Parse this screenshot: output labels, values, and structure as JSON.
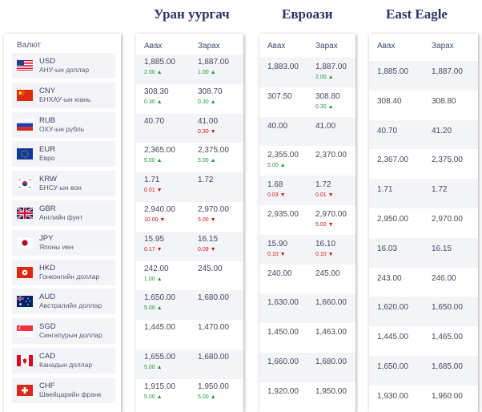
{
  "banks": {
    "ub": "Уран уургач",
    "ea": "Евроази",
    "eg": "East Eagle"
  },
  "headers": {
    "currency": "Валют",
    "buy": "Авах",
    "sell": "Зарах"
  },
  "currencies": [
    {
      "code": "USD",
      "name": "АНУ-ын доллар",
      "flag": "us-flag-icon"
    },
    {
      "code": "CNY",
      "name": "БНХАУ-ын юань",
      "flag": "cn-flag-icon"
    },
    {
      "code": "RUB",
      "name": "ОХУ-ын рубль",
      "flag": "ru-flag-icon"
    },
    {
      "code": "EUR",
      "name": "Евро",
      "flag": "eu-flag-icon"
    },
    {
      "code": "KRW",
      "name": "БНСУ-ын вон",
      "flag": "kr-flag-icon"
    },
    {
      "code": "GBR",
      "name": "Английн фунт",
      "flag": "gb-flag-icon"
    },
    {
      "code": "JPY",
      "name": "Японы иен",
      "flag": "jp-flag-icon"
    },
    {
      "code": "HKD",
      "name": "Гонконгийн доллар",
      "flag": "hk-flag-icon"
    },
    {
      "code": "AUD",
      "name": "Австралийн доллар",
      "flag": "au-flag-icon"
    },
    {
      "code": "SGD",
      "name": "Сингапурын доллар",
      "flag": "sg-flag-icon"
    },
    {
      "code": "CAD",
      "name": "Канадын доллар",
      "flag": "ca-flag-icon"
    },
    {
      "code": "CHF",
      "name": "Швейцарийн франк",
      "flag": "ch-flag-icon"
    }
  ],
  "rates": {
    "ub": [
      {
        "buy": "1,885.00",
        "buy_chg": "2.00",
        "buy_dir": "up",
        "sell": "1,887.00",
        "sell_chg": "1.00",
        "sell_dir": "up"
      },
      {
        "buy": "308.30",
        "buy_chg": "0.30",
        "buy_dir": "up",
        "sell": "308.70",
        "sell_chg": "0.30",
        "sell_dir": "up"
      },
      {
        "buy": "40.70",
        "buy_chg": "",
        "buy_dir": "",
        "sell": "41.00",
        "sell_chg": "0.30",
        "sell_dir": "down"
      },
      {
        "buy": "2,365.00",
        "buy_chg": "5.00",
        "buy_dir": "up",
        "sell": "2,375.00",
        "sell_chg": "5.00",
        "sell_dir": "up"
      },
      {
        "buy": "1.71",
        "buy_chg": "0.01",
        "buy_dir": "down",
        "sell": "1.72",
        "sell_chg": "",
        "sell_dir": ""
      },
      {
        "buy": "2,940.00",
        "buy_chg": "10.00",
        "buy_dir": "down",
        "sell": "2,970.00",
        "sell_chg": "5.00",
        "sell_dir": "down"
      },
      {
        "buy": "15.95",
        "buy_chg": "0.17",
        "buy_dir": "down",
        "sell": "16.15",
        "sell_chg": "0.09",
        "sell_dir": "down"
      },
      {
        "buy": "242.00",
        "buy_chg": "1.00",
        "buy_dir": "up",
        "sell": "245.00",
        "sell_chg": "",
        "sell_dir": ""
      },
      {
        "buy": "1,650.00",
        "buy_chg": "5.00",
        "buy_dir": "up",
        "sell": "1,680.00",
        "sell_chg": "",
        "sell_dir": ""
      },
      {
        "buy": "1,445.00",
        "buy_chg": "",
        "buy_dir": "",
        "sell": "1,470.00",
        "sell_chg": "",
        "sell_dir": ""
      },
      {
        "buy": "1,655.00",
        "buy_chg": "5.00",
        "buy_dir": "up",
        "sell": "1,680.00",
        "sell_chg": "",
        "sell_dir": ""
      },
      {
        "buy": "1,915.00",
        "buy_chg": "5.00",
        "buy_dir": "up",
        "sell": "1,950.00",
        "sell_chg": "5.00",
        "sell_dir": "up"
      }
    ],
    "ea": [
      {
        "buy": "1,883.00",
        "buy_chg": "",
        "buy_dir": "",
        "sell": "1,887.00",
        "sell_chg": "2.00",
        "sell_dir": "up"
      },
      {
        "buy": "307.50",
        "buy_chg": "",
        "buy_dir": "",
        "sell": "308.80",
        "sell_chg": "0.30",
        "sell_dir": "up"
      },
      {
        "buy": "40.00",
        "buy_chg": "",
        "buy_dir": "",
        "sell": "41.00",
        "sell_chg": "",
        "sell_dir": ""
      },
      {
        "buy": "2,355.00",
        "buy_chg": "5.00",
        "buy_dir": "up",
        "sell": "2,370.00",
        "sell_chg": "",
        "sell_dir": ""
      },
      {
        "buy": "1.68",
        "buy_chg": "0.03",
        "buy_dir": "down",
        "sell": "1.72",
        "sell_chg": "0.01",
        "sell_dir": "down"
      },
      {
        "buy": "2,935.00",
        "buy_chg": "",
        "buy_dir": "",
        "sell": "2,970.00",
        "sell_chg": "5.00",
        "sell_dir": "down"
      },
      {
        "buy": "15.90",
        "buy_chg": "0.10",
        "buy_dir": "down",
        "sell": "16.10",
        "sell_chg": "0.10",
        "sell_dir": "down"
      },
      {
        "buy": "240.00",
        "buy_chg": "",
        "buy_dir": "",
        "sell": "245.00",
        "sell_chg": "",
        "sell_dir": ""
      },
      {
        "buy": "1,630.00",
        "buy_chg": "",
        "buy_dir": "",
        "sell": "1,660.00",
        "sell_chg": "",
        "sell_dir": ""
      },
      {
        "buy": "1,450.00",
        "buy_chg": "",
        "buy_dir": "",
        "sell": "1,463.00",
        "sell_chg": "",
        "sell_dir": ""
      },
      {
        "buy": "1,660.00",
        "buy_chg": "",
        "buy_dir": "",
        "sell": "1,680.00",
        "sell_chg": "",
        "sell_dir": ""
      },
      {
        "buy": "1,920.00",
        "buy_chg": "",
        "buy_dir": "",
        "sell": "1,950.00",
        "sell_chg": "",
        "sell_dir": ""
      }
    ],
    "eg": [
      {
        "buy": "1,885.00",
        "sell": "1,887.00"
      },
      {
        "buy": "308.40",
        "sell": "308.80"
      },
      {
        "buy": "40.70",
        "sell": "41.20"
      },
      {
        "buy": "2,367.00",
        "sell": "2,375.00"
      },
      {
        "buy": "1.71",
        "sell": "1.72"
      },
      {
        "buy": "2,950.00",
        "sell": "2,970.00"
      },
      {
        "buy": "16.03",
        "sell": "16.15"
      },
      {
        "buy": "243.00",
        "sell": "246.00"
      },
      {
        "buy": "1,620.00",
        "sell": "1,650.00"
      },
      {
        "buy": "1,445.00",
        "sell": "1,465.00"
      },
      {
        "buy": "1,650.00",
        "sell": "1,685.00"
      },
      {
        "buy": "1,930.00",
        "sell": "1,960.00"
      }
    ]
  },
  "colors": {
    "up": "#1d9a3a",
    "down": "#d01818",
    "title": "#2c3566",
    "stripe": "#f3f4f8"
  }
}
